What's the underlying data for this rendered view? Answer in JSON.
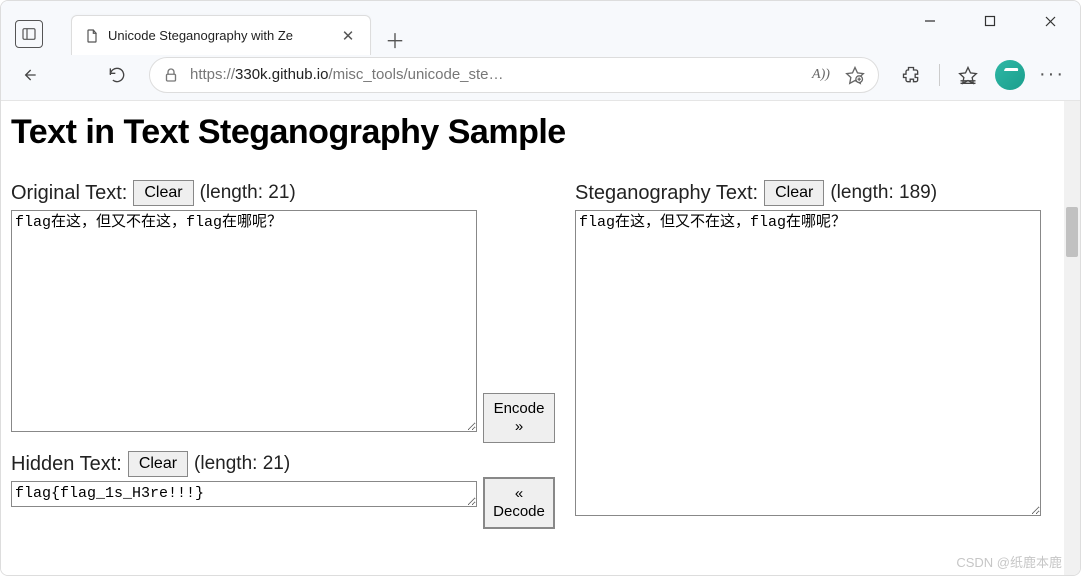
{
  "browser": {
    "tab_title": "Unicode Steganography with Ze",
    "url_scheme": "https://",
    "url_host": "330k.github.io",
    "url_path": "/misc_tools/unicode_ste…",
    "read_aloud": "A))"
  },
  "page": {
    "title": "Text in Text Steganography Sample",
    "original": {
      "label": "Original Text:",
      "clear": "Clear",
      "length_label": "(length: 21)",
      "value": "flag在这，但又不在这，flag在哪呢？"
    },
    "hidden": {
      "label": "Hidden Text:",
      "clear": "Clear",
      "length_label": "(length: 21)",
      "value": "flag{flag_1s_H3re!!!}"
    },
    "steg": {
      "label": "Steganography Text:",
      "clear": "Clear",
      "length_label": "(length: 189)",
      "value": "flag在这，但又不在这，flag在哪呢？"
    },
    "encode": "Encode\n»",
    "decode": "«\nDecode"
  },
  "watermark": "CSDN @纸鹿本鹿"
}
